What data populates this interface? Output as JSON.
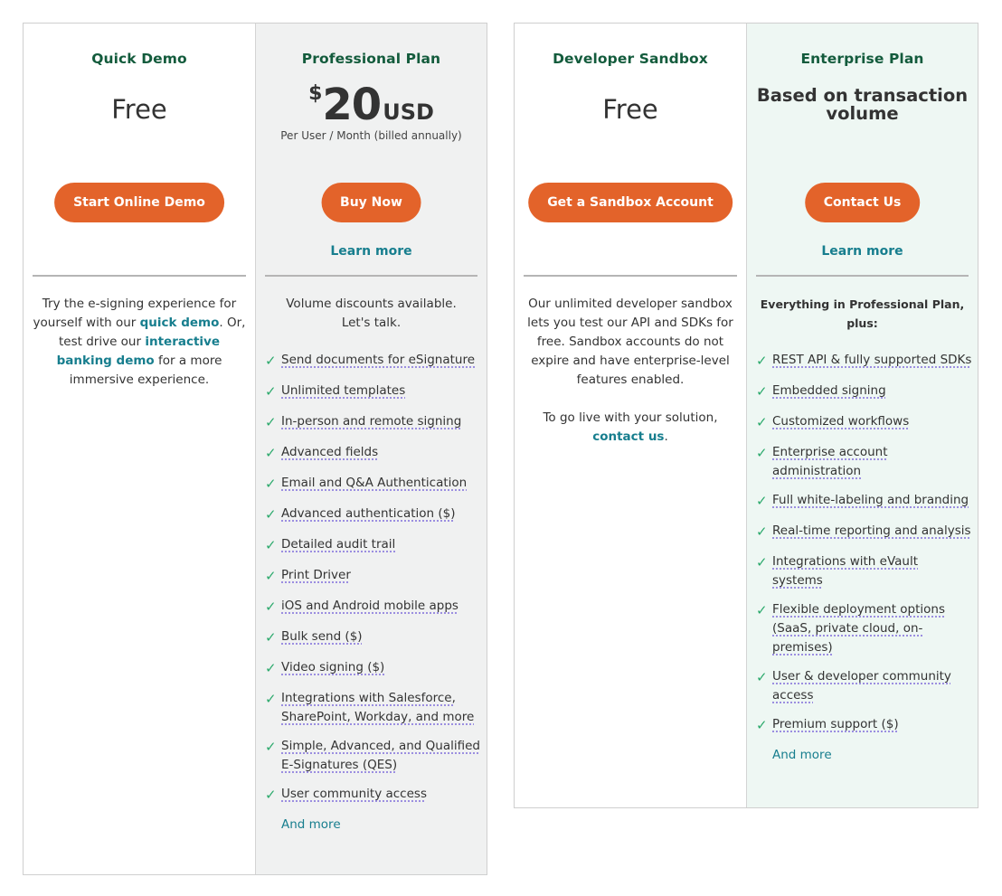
{
  "plans": {
    "quick_demo": {
      "name": "Quick Demo",
      "price": "Free",
      "cta": "Start Online Demo",
      "desc": {
        "part1": "Try the e-signing experience for yourself with our ",
        "link1": "quick demo",
        "part2": ". Or, test drive our ",
        "link2": "interactive banking demo",
        "part3": " for a more immersive experience."
      }
    },
    "professional": {
      "name": "Professional Plan",
      "currency_symbol": "$",
      "amount": "20",
      "currency": "USD",
      "price_sub": "Per User / Month (billed annually)",
      "cta": "Buy Now",
      "learn_more": "Learn more",
      "intro": "Volume discounts available. Let's talk.",
      "features": [
        "Send documents for eSignature",
        "Unlimited templates",
        "In-person and remote signing",
        "Advanced fields",
        "Email and Q&A Authentication",
        "Advanced authentication ($)",
        "Detailed audit trail",
        "Print Driver",
        "iOS and Android mobile apps",
        "Bulk send ($)",
        "Video signing ($)",
        "Integrations with Salesforce, SharePoint, Workday, and more",
        "Simple, Advanced, and Qualified E-Signatures (QES)",
        "User community access"
      ],
      "and_more": "And more"
    },
    "sandbox": {
      "name": "Developer Sandbox",
      "price": "Free",
      "cta": "Get a Sandbox Account",
      "desc1": "Our unlimited developer sandbox lets you test our API and SDKs for free. Sandbox accounts do not expire and have enterprise-level features enabled.",
      "desc2_part1": "To go live with your solution, ",
      "desc2_link": "contact us",
      "desc2_part2": "."
    },
    "enterprise": {
      "name": "Enterprise Plan",
      "price": "Based on transaction volume",
      "cta": "Contact Us",
      "learn_more": "Learn more",
      "intro": "Everything in Professional Plan, plus:",
      "features": [
        "REST API & fully supported SDKs",
        "Embedded signing",
        "Customized workflows",
        "Enterprise account administration",
        "Full white-labeling and branding",
        "Real-time reporting and analysis",
        "Integrations with eVault systems",
        "Flexible deployment options (SaaS, private cloud, on-premises)",
        "User & developer community access",
        "Premium support ($)"
      ],
      "and_more": "And more"
    }
  },
  "icons": {
    "feature_check": "check-icon"
  },
  "colors": {
    "plan_name": "#135b3c",
    "cta_bg": "#e3632a",
    "link": "#177e8e",
    "check": "#2daa6d",
    "professional_bg": "#f0f1f1",
    "enterprise_bg": "#eef7f3"
  }
}
